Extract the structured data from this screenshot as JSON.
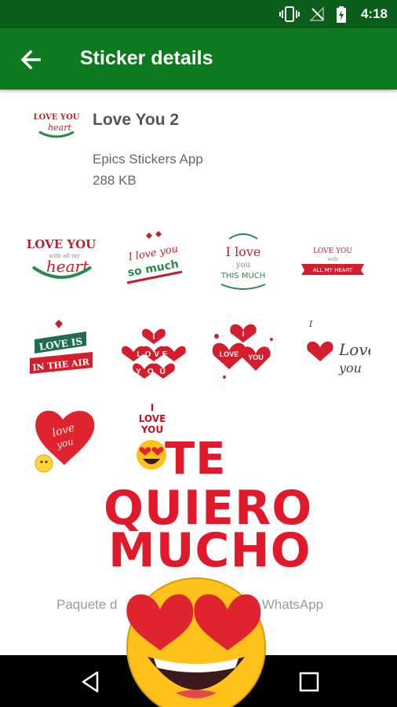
{
  "status_bar": {
    "time": "4:18",
    "icons": [
      "vibrate-icon",
      "no-signal-icon",
      "battery-charging-icon"
    ],
    "bg_color": "#0b5e1a"
  },
  "app_bar": {
    "title": "Sticker details",
    "back_icon": "arrow-back-icon",
    "bg_color": "#0e7a20"
  },
  "pack": {
    "name": "Love You 2",
    "publisher": "Epics Stickers App",
    "size": "288 KB",
    "thumbnail_text": [
      "LOVE YOU",
      "heart"
    ]
  },
  "stickers": [
    {
      "id": "s1",
      "lines": [
        "LOVE YOU",
        "with all my",
        "heart"
      ]
    },
    {
      "id": "s2",
      "lines": [
        "I love you",
        "so much"
      ]
    },
    {
      "id": "s3",
      "lines": [
        "I love",
        "you",
        "THIS MUCH"
      ]
    },
    {
      "id": "s4",
      "lines": [
        "LOVE YOU",
        "with",
        "ALL MY HEART"
      ]
    },
    {
      "id": "s5",
      "lines": [
        "LOVE IS",
        "IN THE AIR"
      ]
    },
    {
      "id": "s6",
      "lines": [
        "I",
        "LOVE",
        "YOU"
      ]
    },
    {
      "id": "s7",
      "lines": [
        "I",
        "LOVE",
        "YOU"
      ]
    },
    {
      "id": "s8",
      "lines": [
        "I",
        "Love",
        "you"
      ]
    },
    {
      "id": "s9",
      "lines": [
        "love",
        "you"
      ]
    }
  ],
  "overlay_sticker": {
    "small_text": [
      "I",
      "LOVE",
      "YOU"
    ],
    "line1": "TE",
    "line2": "QUIERO",
    "line3": "MUCHO"
  },
  "footer": {
    "text": "Paquete de stickers para WhatsApp",
    "visible_left": "Paquete d",
    "visible_right": "a WhatsApp"
  },
  "nav_bar": {
    "icons": [
      "back-triangle-icon",
      "home-circle-icon",
      "recents-square-icon"
    ]
  },
  "accent_red": "#e01a2a",
  "accent_green": "#0e7a20"
}
